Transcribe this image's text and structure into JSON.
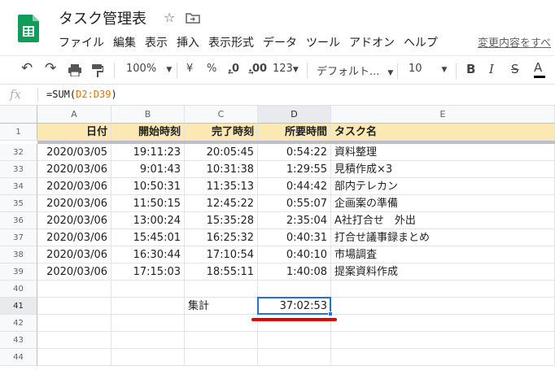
{
  "app": {
    "title": "タスク管理表",
    "menu": [
      "ファイル",
      "編集",
      "表示",
      "挿入",
      "表示形式",
      "データ",
      "ツール",
      "アドオン",
      "ヘルプ"
    ],
    "last_edit": "変更内容をすべ"
  },
  "toolbar": {
    "zoom": "100%",
    "currency": "¥",
    "percent": "%",
    "dec_decrease": ".0",
    "dec_increase": ".00",
    "format_more": "123",
    "font": "デフォルト...",
    "font_size": "10",
    "bold": "B",
    "italic": "I",
    "strike": "S",
    "text_color": "A",
    "text_color_value": "#000000"
  },
  "formula_bar": {
    "fx": "fx",
    "prefix": "=SUM(",
    "range": "D2:D39",
    "suffix": ")"
  },
  "sheet": {
    "columns": [
      "A",
      "B",
      "C",
      "D",
      "E"
    ],
    "selected_column": "D",
    "header_row_number": "1",
    "headers": [
      "日付",
      "開始時刻",
      "完了時刻",
      "所要時間",
      "タスク名"
    ],
    "header_fill": "#fce8b2",
    "rows": [
      {
        "num": "32",
        "date": "2020/03/05",
        "start": "19:11:23",
        "end": "20:05:45",
        "duration": "0:54:22",
        "task": "資料整理"
      },
      {
        "num": "33",
        "date": "2020/03/06",
        "start": "9:01:43",
        "end": "10:31:38",
        "duration": "1:29:55",
        "task": "見積作成×3"
      },
      {
        "num": "34",
        "date": "2020/03/06",
        "start": "10:50:31",
        "end": "11:35:13",
        "duration": "0:44:42",
        "task": "部内テレカン"
      },
      {
        "num": "35",
        "date": "2020/03/06",
        "start": "11:50:15",
        "end": "12:45:22",
        "duration": "0:55:07",
        "task": "企画案の準備"
      },
      {
        "num": "36",
        "date": "2020/03/06",
        "start": "13:00:24",
        "end": "15:35:28",
        "duration": "2:35:04",
        "task": "A社打合せ　外出"
      },
      {
        "num": "37",
        "date": "2020/03/06",
        "start": "15:45:01",
        "end": "16:25:32",
        "duration": "0:40:31",
        "task": "打合せ議事録まとめ"
      },
      {
        "num": "38",
        "date": "2020/03/06",
        "start": "16:30:44",
        "end": "17:10:54",
        "duration": "0:40:10",
        "task": "市場調査"
      },
      {
        "num": "39",
        "date": "2020/03/06",
        "start": "17:15:03",
        "end": "18:55:11",
        "duration": "1:40:08",
        "task": "提案資料作成"
      }
    ],
    "empty_rows": [
      "40",
      "41",
      "42",
      "43",
      "44"
    ],
    "selected_row": "41",
    "total_label": "集計",
    "total_value": "37:02:53",
    "selection_color": "#1a73e8",
    "highlight_color": "#e00000"
  }
}
